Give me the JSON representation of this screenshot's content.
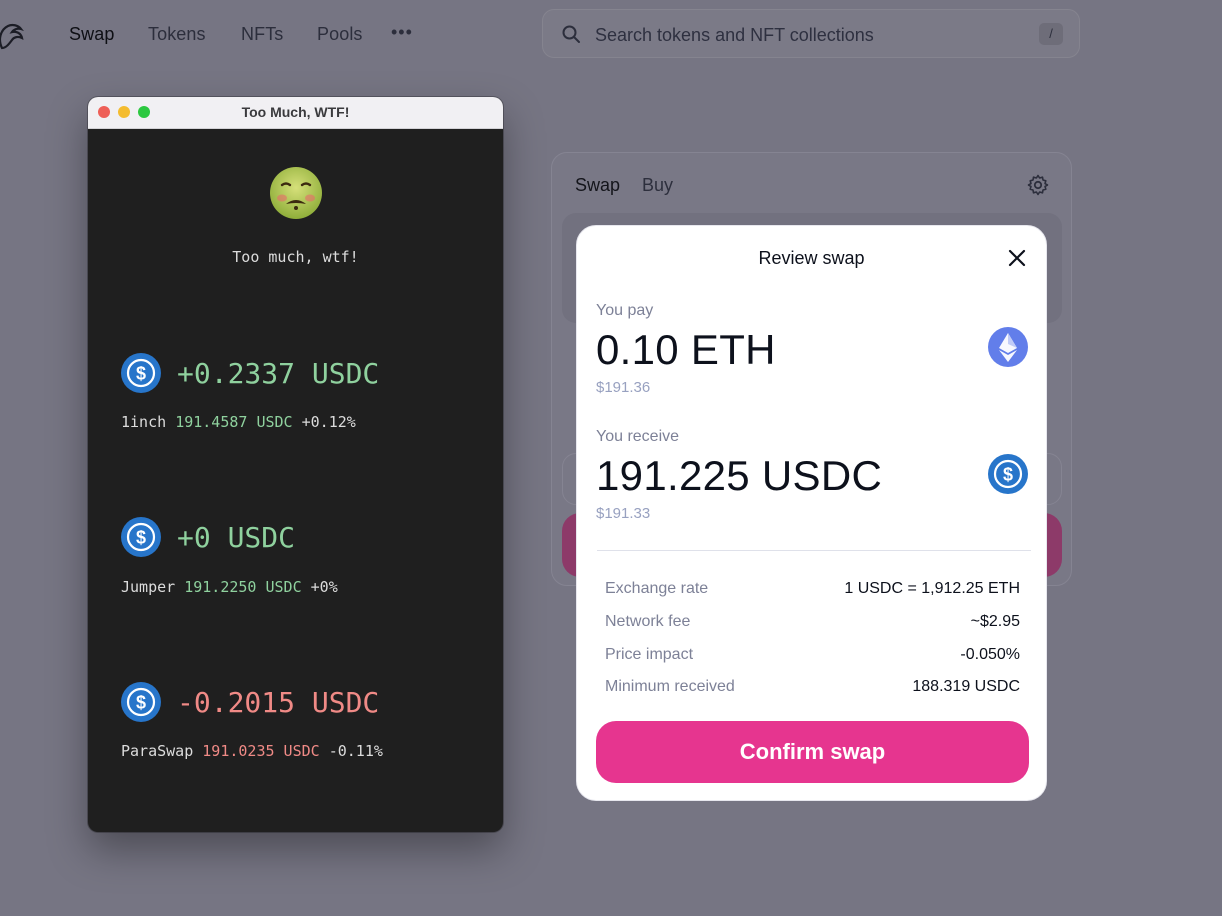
{
  "nav": {
    "items": [
      {
        "label": "Swap"
      },
      {
        "label": "Tokens"
      },
      {
        "label": "NFTs"
      },
      {
        "label": "Pools"
      }
    ],
    "more": "•••",
    "search_placeholder": "Search tokens and NFT collections",
    "search_shortcut": "/"
  },
  "swap_card": {
    "tabs": [
      "Swap",
      "Buy"
    ]
  },
  "terminal": {
    "title": "Too Much, WTF!",
    "heading": "Too much, wtf!",
    "quotes": [
      {
        "amount": "+0.2337 USDC",
        "source": "1inch",
        "price": "191.4587 USDC",
        "diff": "+0.12%",
        "tone": "green"
      },
      {
        "amount": "+0 USDC",
        "source": "Jumper",
        "price": "191.2250 USDC",
        "diff": "+0%",
        "tone": "green"
      },
      {
        "amount": "-0.2015 USDC",
        "source": "ParaSwap",
        "price": "191.0235 USDC",
        "diff": "-0.11%",
        "tone": "red"
      }
    ]
  },
  "review": {
    "title": "Review swap",
    "pay_label": "You pay",
    "pay_amount": "0.10 ETH",
    "pay_usd": "$191.36",
    "receive_label": "You receive",
    "receive_amount": "191.225 USDC",
    "receive_usd": "$191.33",
    "details": [
      {
        "key": "Exchange rate",
        "value": "1 USDC = 1,912.25 ETH"
      },
      {
        "key": "Network fee",
        "value": "~$2.95"
      },
      {
        "key": "Price impact",
        "value": "-0.050%"
      },
      {
        "key": "Minimum received",
        "value": "188.319 USDC"
      }
    ],
    "confirm_label": "Confirm swap"
  },
  "colors": {
    "accent": "#e6358f",
    "gain": "#8fd19e",
    "loss": "#f08a86",
    "usdc": "#2775ca",
    "eth": "#627eea"
  },
  "icons": [
    "uniswap-logo-icon",
    "more-dots-icon",
    "search-icon",
    "gear-icon",
    "nauseated-face-icon",
    "usdc-coin-icon",
    "eth-coin-icon",
    "close-icon"
  ]
}
